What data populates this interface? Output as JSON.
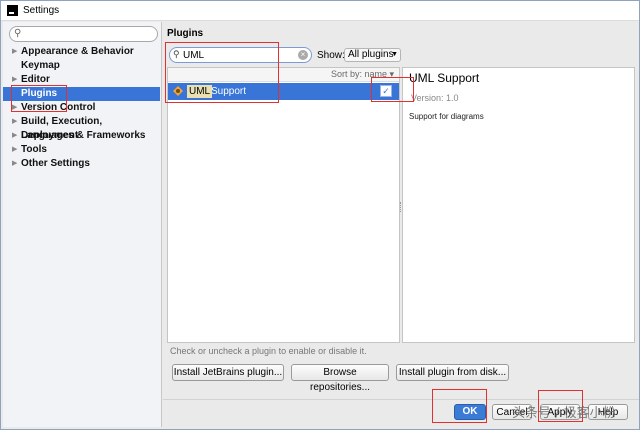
{
  "window": {
    "title": "Settings"
  },
  "sidebar": {
    "search_placeholder": "",
    "items": [
      {
        "label": "Appearance & Behavior",
        "expandable": true,
        "selected": false
      },
      {
        "label": "Keymap",
        "expandable": false,
        "selected": false
      },
      {
        "label": "Editor",
        "expandable": true,
        "selected": false
      },
      {
        "label": "Plugins",
        "expandable": false,
        "selected": true
      },
      {
        "label": "Version Control",
        "expandable": true,
        "selected": false
      },
      {
        "label": "Build, Execution, Deployment",
        "expandable": true,
        "selected": false
      },
      {
        "label": "Languages & Frameworks",
        "expandable": true,
        "selected": false
      },
      {
        "label": "Tools",
        "expandable": true,
        "selected": false
      },
      {
        "label": "Other Settings",
        "expandable": true,
        "selected": false
      }
    ]
  },
  "plugins": {
    "section_title": "Plugins",
    "search_value": "UML",
    "show_label": "Show:",
    "show_value": "All plugins",
    "sort_label": "Sort by: name",
    "list": [
      {
        "highlight": "UML",
        "rest": "Support",
        "enabled": true,
        "selected": true
      }
    ],
    "detail": {
      "name": "UML Support",
      "version": "Version: 1.0",
      "description": "Support for diagrams"
    },
    "hint": "Check or uncheck a plugin to enable or disable it.",
    "buttons": {
      "install_jetbrains": "Install JetBrains plugin...",
      "browse": "Browse repositories...",
      "from_disk": "Install plugin from disk..."
    }
  },
  "dialog_buttons": {
    "ok": "OK",
    "cancel": "Cancel",
    "apply": "Apply",
    "help": "Help"
  },
  "watermark": "头条号 / 极客小粉",
  "colors": {
    "selection": "#3875d7",
    "annotation": "#e03030"
  }
}
